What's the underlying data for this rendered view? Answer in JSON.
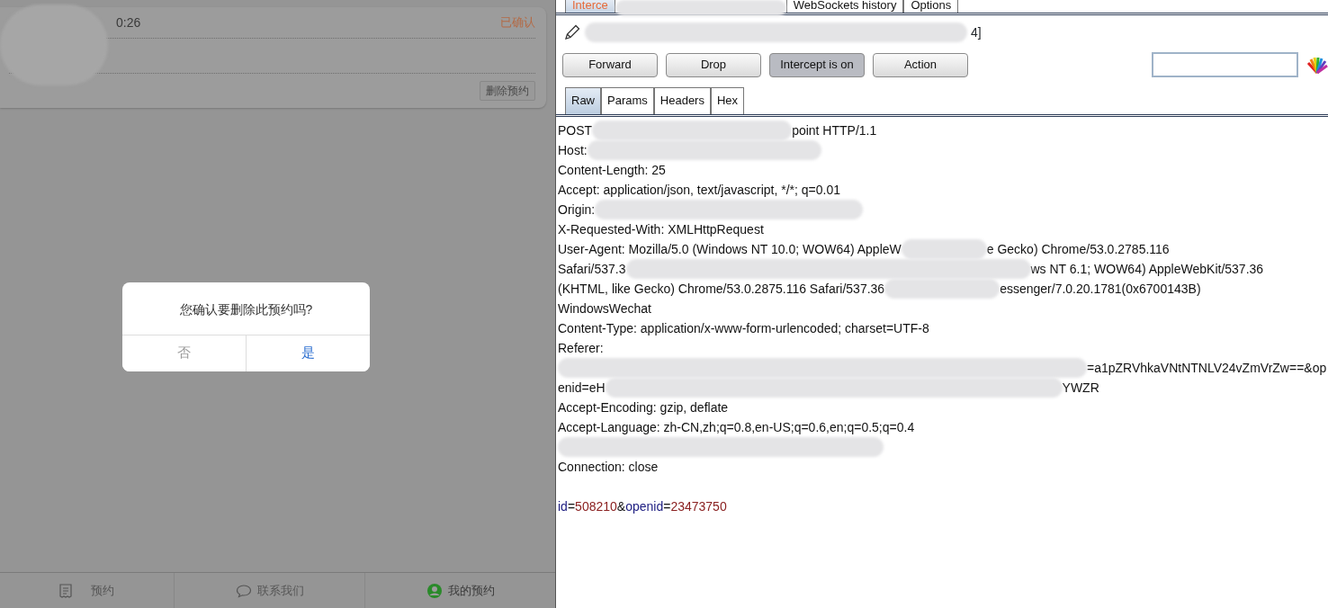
{
  "mobile": {
    "card": {
      "time": "0:26",
      "status": "已确认",
      "delete_button": "删除预约"
    },
    "dialog": {
      "message": "您确认要删除此预约吗?",
      "buttons": [
        {
          "label": "否",
          "kind": "cancel"
        },
        {
          "label": "是",
          "kind": "confirm"
        }
      ]
    },
    "bottom_nav": [
      {
        "label": "预约",
        "kind": "receipt",
        "selected": false
      },
      {
        "label": "联系我们",
        "kind": "chat",
        "selected": false
      },
      {
        "label": "我的预约",
        "kind": "user",
        "selected": true
      }
    ]
  },
  "proxy": {
    "tabs": [
      {
        "label": "Interce",
        "selected": true
      },
      {
        "label": "WebSockets history",
        "selected": false
      },
      {
        "label": "Options",
        "selected": false
      }
    ],
    "request_title": "4]",
    "buttons": [
      {
        "label": "Forward",
        "pressed": false
      },
      {
        "label": "Drop",
        "pressed": false
      },
      {
        "label": "Intercept is on",
        "pressed": true
      },
      {
        "label": "Action",
        "pressed": false
      }
    ],
    "view_tabs": [
      {
        "label": "Raw",
        "selected": true
      },
      {
        "label": "Params",
        "selected": false
      },
      {
        "label": "Headers",
        "selected": false
      },
      {
        "label": "Hex",
        "selected": false
      }
    ],
    "request_lines": [
      [
        {
          "kind": "text",
          "text": "POST"
        },
        {
          "kind": "redacted"
        },
        {
          "kind": "text",
          "text": "point HTTP/1.1"
        }
      ],
      [
        {
          "kind": "text",
          "text": "Host:"
        },
        {
          "kind": "redacted"
        }
      ],
      [
        {
          "kind": "text",
          "text": "Content-Length: 25"
        }
      ],
      [
        {
          "kind": "text",
          "text": "Accept: application/json, text/javascript, */*; q=0.01"
        }
      ],
      [
        {
          "kind": "text",
          "text": "Origin:"
        },
        {
          "kind": "redacted"
        }
      ],
      [
        {
          "kind": "text",
          "text": "X-Requested-With: XMLHttpRequest"
        }
      ],
      [
        {
          "kind": "text",
          "text": "User-Agent: Mozilla/5.0 (Windows NT 10.0; WOW64) AppleW"
        },
        {
          "kind": "redacted"
        },
        {
          "kind": "text",
          "text": "e Gecko) Chrome/53.0.2785.116"
        }
      ],
      [
        {
          "kind": "text",
          "text": "Safari/537.3"
        },
        {
          "kind": "redacted"
        },
        {
          "kind": "text",
          "text": "ws NT 6.1; WOW64) AppleWebKit/537.36"
        }
      ],
      [
        {
          "kind": "text",
          "text": "(KHTML, like Gecko) Chrome/53.0.2875.116 Safari/537.36"
        },
        {
          "kind": "redacted"
        },
        {
          "kind": "text",
          "text": "essenger/7.0.20.1781(0x6700143B)"
        }
      ],
      [
        {
          "kind": "text",
          "text": "WindowsWechat"
        }
      ],
      [
        {
          "kind": "text",
          "text": "Content-Type: application/x-www-form-urlencoded; charset=UTF-8"
        }
      ],
      [
        {
          "kind": "text",
          "text": "Referer:"
        }
      ],
      [
        {
          "kind": "redacted"
        },
        {
          "kind": "text",
          "text": "=a1pZRVhkaVNtNTNLV24vZmVrZw==&op"
        }
      ],
      [
        {
          "kind": "text",
          "text": "enid=eH"
        },
        {
          "kind": "redacted"
        },
        {
          "kind": "text",
          "text": "YWZR"
        }
      ],
      [
        {
          "kind": "text",
          "text": "Accept-Encoding: gzip, deflate"
        }
      ],
      [
        {
          "kind": "text",
          "text": "Accept-Language: zh-CN,zh;q=0.8,en-US;q=0.6,en;q=0.5;q=0.4"
        }
      ],
      [
        {
          "kind": "redacted"
        }
      ],
      [
        {
          "kind": "text",
          "text": "Connection: close"
        }
      ]
    ],
    "body": [
      {
        "kind": "param_name",
        "text": "id"
      },
      {
        "kind": "text",
        "text": "="
      },
      {
        "kind": "param_value",
        "text": "508210"
      },
      {
        "kind": "text",
        "text": "&"
      },
      {
        "kind": "param_name",
        "text": "openid"
      },
      {
        "kind": "text",
        "text": "="
      },
      {
        "kind": "param_value",
        "text": "23473750"
      }
    ]
  }
}
